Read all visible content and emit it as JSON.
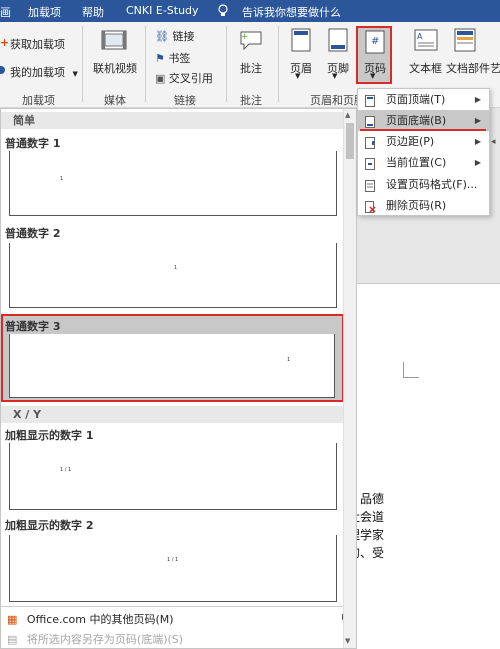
{
  "title_bar": {
    "tab_cut": "画",
    "tab_addins": "加载项",
    "tab_help": "帮助",
    "tab_cnki": "CNKI E-Study",
    "tell_me": "告诉我你想要做什么"
  },
  "ribbon": {
    "get_addins": "获取加载项",
    "my_addins": "我的加载项",
    "online_video": "联机视频",
    "link": "链接",
    "bookmark": "书签",
    "cross_ref": "交叉引用",
    "comment": "批注",
    "header": "页眉",
    "footer": "页脚",
    "page_number": "页码",
    "textbox": "文本框",
    "doc_parts": "文档部件",
    "art_cut": "艺",
    "groups": {
      "addins": "加载项",
      "media": "媒体",
      "links": "链接",
      "comments": "批注",
      "header_footer": "页眉和页脚"
    }
  },
  "menu": {
    "items": [
      {
        "label": "页面顶端(T)",
        "has_submenu": true,
        "active": false
      },
      {
        "label": "页面底端(B)",
        "has_submenu": true,
        "active": true
      },
      {
        "label": "页边距(P)",
        "has_submenu": true,
        "active": false
      },
      {
        "label": "当前位置(C)",
        "has_submenu": true,
        "active": false
      },
      {
        "label": "设置页码格式(F)...",
        "has_submenu": false,
        "active": false
      },
      {
        "label": "删除页码(R)",
        "has_submenu": false,
        "active": false
      }
    ]
  },
  "gallery": {
    "section_simple": "简单",
    "section_xy": "X / Y",
    "items": [
      {
        "title": "普通数字 1",
        "sample": "1"
      },
      {
        "title": "普通数字 2",
        "sample": "1"
      },
      {
        "title": "普通数字 3",
        "sample": "1",
        "highlighted": true
      },
      {
        "title": "加粗显示的数字 1",
        "sample": "1 / 1"
      },
      {
        "title": "加粗显示的数字 2",
        "sample": "1 / 1"
      }
    ],
    "footer_more": "Office.com 中的其他页码(M)",
    "footer_save": "将所选内容另存为页码(底端)(S)"
  },
  "document": {
    "lines": [
      "。品德",
      "社会道",
      "理学家",
      "的、受"
    ]
  },
  "colors": {
    "ribbon_blue": "#2b579a",
    "highlight_red": "#d92a2a",
    "selection_gray": "#c8c8c8"
  }
}
